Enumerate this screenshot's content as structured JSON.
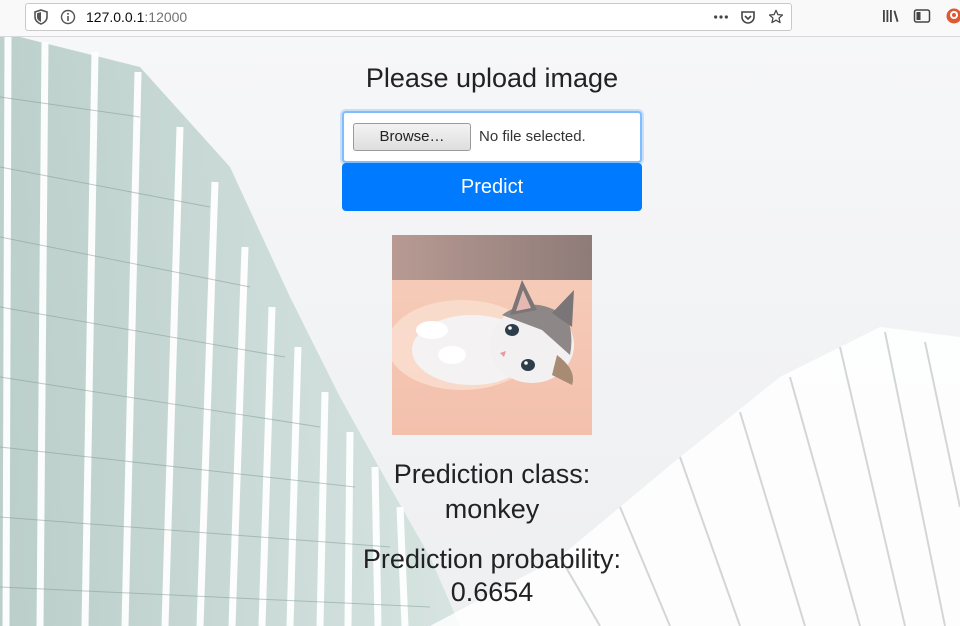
{
  "browser": {
    "url_host": "127.0.0.1",
    "url_port": ":12000"
  },
  "page": {
    "title": "Please upload image",
    "browse_label": "Browse…",
    "file_status": "No file selected.",
    "predict_label": "Predict",
    "image_alt": "kitten",
    "class_label": "Prediction class:",
    "class_value": "monkey",
    "prob_label": "Prediction probability:",
    "prob_value": "0.6654"
  },
  "colors": {
    "accent": "#007bff",
    "focus_ring": "#80bdff"
  },
  "icons": [
    "shield-icon",
    "info-icon",
    "more-icon",
    "pocket-icon",
    "bookmark-star-icon",
    "library-icon",
    "sidebar-icon",
    "extension-icon"
  ]
}
